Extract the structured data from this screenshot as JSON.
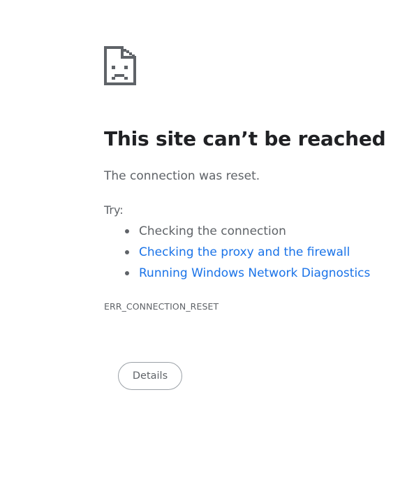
{
  "error_page": {
    "icon": "sad-page-icon",
    "title": "This site can’t be reached",
    "subtitle": "The connection was reset.",
    "try_label": "Try:",
    "suggestions": [
      {
        "text": "Checking the connection",
        "is_link": false
      },
      {
        "text": "Checking the proxy and the firewall",
        "is_link": true
      },
      {
        "text": "Running Windows Network Diagnostics",
        "is_link": true
      }
    ],
    "error_code": "ERR_CONNECTION_RESET",
    "details_button_label": "Details"
  },
  "colors": {
    "title": "#202124",
    "body_text": "#5f6368",
    "link": "#1a73e8",
    "icon": "#5f6368",
    "button_border": "#9aa0a6"
  }
}
